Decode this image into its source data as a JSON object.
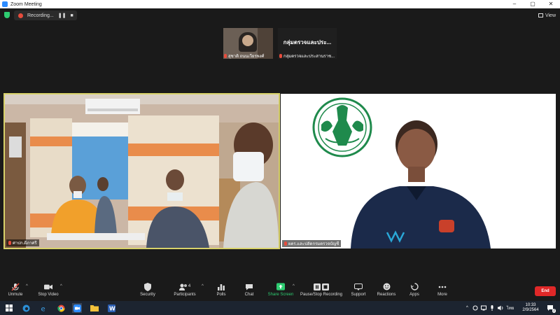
{
  "window": {
    "title": "Zoom Meeting",
    "controls": [
      "–",
      "▢",
      "✕"
    ]
  },
  "recording": {
    "label": "Recording...",
    "pause": "❚❚",
    "stop": "■"
  },
  "view": {
    "label": "View"
  },
  "thumbnails": [
    {
      "name": "สุชาติ ถนนเวียรพงศ์"
    },
    {
      "display_text": "กลุ่มตรวจและประ...",
      "name": "กลุ่มตรวจและประสานราช..."
    }
  ],
  "videos": [
    {
      "name": "ศาปก.ดีภาศรี"
    },
    {
      "name": "ผตร.และปลัดกรมตรวจบัญชี"
    }
  ],
  "toolbar": {
    "unmute": "Unmute",
    "stop_video": "Stop Video",
    "security": "Security",
    "participants": "Participants",
    "participants_count": "4",
    "polls": "Polls",
    "chat": "Chat",
    "share_screen": "Share Screen",
    "record": "Pause/Stop Recording",
    "support": "Support",
    "reactions": "Reactions",
    "apps": "Apps",
    "more": "More",
    "end": "End"
  },
  "taskbar": {
    "language": "ไทย",
    "time": "10:33",
    "date": "2/9/2564",
    "notification_count": "2"
  },
  "colors": {
    "active_speaker_border": "#d8d26a",
    "share_green": "#2ecc71",
    "end_red": "#e02828"
  }
}
